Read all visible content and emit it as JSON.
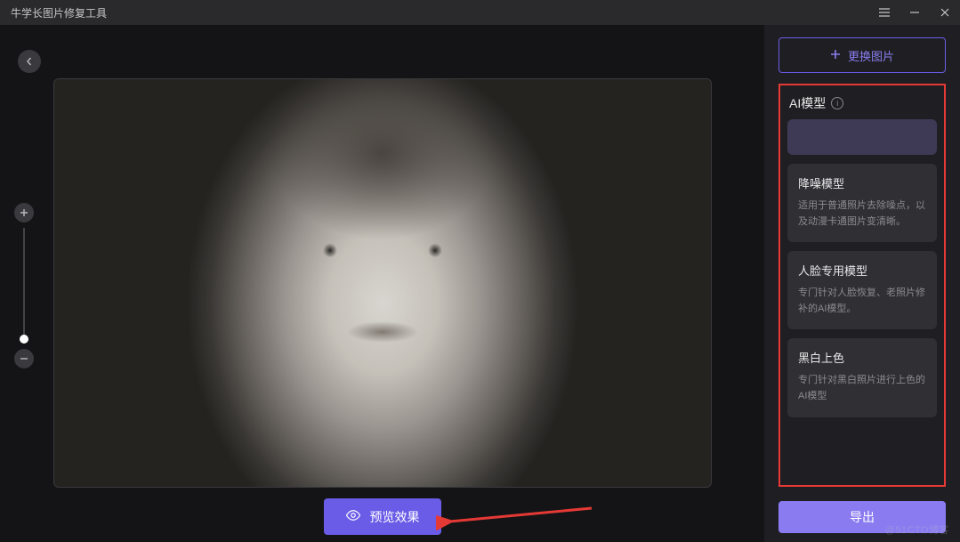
{
  "app": {
    "title": "牛学长图片修复工具"
  },
  "toolbar": {
    "change_image_label": "更换图片"
  },
  "ai_section": {
    "title": "AI模型"
  },
  "models": [
    {
      "title": "降噪模型",
      "desc": "适用于普通照片去除噪点，以及动漫卡通图片变清晰。"
    },
    {
      "title": "人脸专用模型",
      "desc": "专门针对人脸恢复、老照片修补的AI模型。"
    },
    {
      "title": "黑白上色",
      "desc": "专门针对黑白照片进行上色的AI模型"
    }
  ],
  "buttons": {
    "preview_label": "预览效果",
    "export_label": "导出"
  },
  "watermark": "@51CTO博客"
}
